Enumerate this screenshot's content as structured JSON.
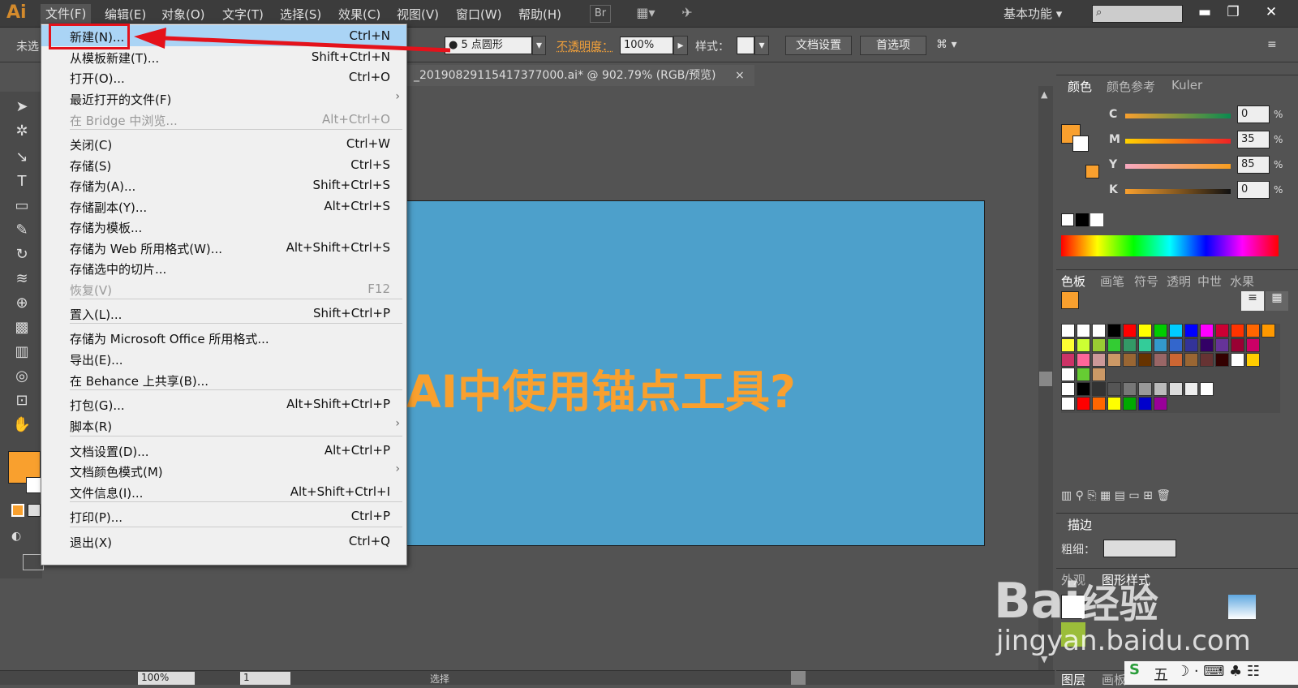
{
  "app": {
    "logo": "Ai"
  },
  "menubar": {
    "items": [
      "文件(F)",
      "编辑(E)",
      "对象(O)",
      "文字(T)",
      "选择(S)",
      "效果(C)",
      "视图(V)",
      "窗口(W)",
      "帮助(H)"
    ],
    "br": "Br",
    "workspace": "基本功能",
    "win_min": "▬",
    "win_restore": "❐",
    "win_close": "✕"
  },
  "control_bar": {
    "no_selection": "未选",
    "brush": "5 点圆形",
    "opacity_label": "不透明度：",
    "opacity_value": "100%",
    "style_label": "样式：",
    "doc_setup": "文档设置",
    "preferences": "首选项"
  },
  "document": {
    "tab_title": "_20190829115417377000.ai* @ 902.79% (RGB/预览)",
    "close": "×"
  },
  "artboard": {
    "text": "AI中使用锚点工具?"
  },
  "file_menu": {
    "items": [
      {
        "label": "新建(N)...",
        "shortcut": "Ctrl+N",
        "state": "highlight"
      },
      {
        "label": "从模板新建(T)...",
        "shortcut": "Shift+Ctrl+N"
      },
      {
        "label": "打开(O)...",
        "shortcut": "Ctrl+O"
      },
      {
        "label": "最近打开的文件(F)",
        "shortcut": "",
        "submenu": "›"
      },
      {
        "label": "在 Bridge 中浏览...",
        "shortcut": "Alt+Ctrl+O",
        "state": "disabled"
      },
      {
        "label": "关闭(C)",
        "shortcut": "Ctrl+W"
      },
      {
        "label": "存储(S)",
        "shortcut": "Ctrl+S"
      },
      {
        "label": "存储为(A)...",
        "shortcut": "Shift+Ctrl+S"
      },
      {
        "label": "存储副本(Y)...",
        "shortcut": "Alt+Ctrl+S"
      },
      {
        "label": "存储为模板...",
        "shortcut": ""
      },
      {
        "label": "存储为 Web 所用格式(W)...",
        "shortcut": "Alt+Shift+Ctrl+S"
      },
      {
        "label": "存储选中的切片...",
        "shortcut": ""
      },
      {
        "label": "恢复(V)",
        "shortcut": "F12",
        "state": "disabled"
      },
      {
        "label": "置入(L)...",
        "shortcut": "Shift+Ctrl+P"
      },
      {
        "label": "存储为 Microsoft Office 所用格式...",
        "shortcut": ""
      },
      {
        "label": "导出(E)...",
        "shortcut": ""
      },
      {
        "label": "在 Behance 上共享(B)...",
        "shortcut": ""
      },
      {
        "label": "打包(G)...",
        "shortcut": "Alt+Shift+Ctrl+P"
      },
      {
        "label": "脚本(R)",
        "shortcut": "",
        "submenu": "›"
      },
      {
        "label": "文档设置(D)...",
        "shortcut": "Alt+Ctrl+P"
      },
      {
        "label": "文档颜色模式(M)",
        "shortcut": "",
        "submenu": "›"
      },
      {
        "label": "文件信息(I)...",
        "shortcut": "Alt+Shift+Ctrl+I"
      },
      {
        "label": "打印(P)...",
        "shortcut": "Ctrl+P"
      },
      {
        "label": "退出(X)",
        "shortcut": "Ctrl+Q"
      }
    ]
  },
  "color_panel": {
    "tabs": [
      "颜色",
      "颜色参考",
      "Kuler"
    ],
    "channels": [
      {
        "name": "C",
        "value": "0",
        "pct": "%"
      },
      {
        "name": "M",
        "value": "35",
        "pct": "%"
      },
      {
        "name": "Y",
        "value": "85",
        "pct": "%"
      },
      {
        "name": "K",
        "value": "0",
        "pct": "%"
      }
    ],
    "fill_color": "#f9a02e"
  },
  "swatches_panel": {
    "tabs": [
      "色板",
      "画笔",
      "符号",
      "透明",
      "中世",
      "水果"
    ]
  },
  "stroke_panel": {
    "title": "描边",
    "weight_label": "粗细："
  },
  "appearance_panel": {
    "tabs": [
      "外观",
      "图形样式"
    ]
  },
  "layers_panel": {
    "tabs": [
      "图层",
      "画板"
    ]
  },
  "status_bar": {
    "zoom": "100%",
    "page": "1",
    "mode": "选择"
  },
  "watermark": {
    "brand": "Bai",
    "brand2": "经验",
    "url": "jingyan.baidu.com"
  },
  "taskbar": {
    "ime": "五"
  }
}
